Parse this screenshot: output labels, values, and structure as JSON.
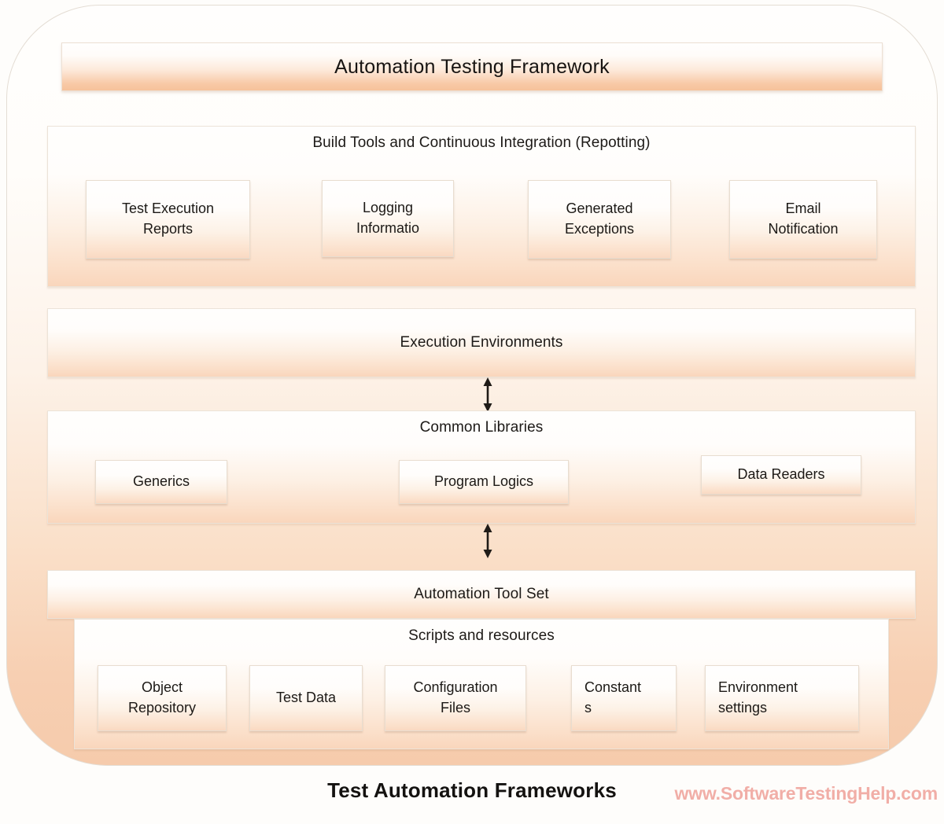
{
  "diagram": {
    "header": {
      "title": "Automation Testing Framework"
    },
    "sections": [
      {
        "id": "build",
        "title": "Build Tools and Continuous Integration (Repotting)",
        "nodes": [
          {
            "id": "reports",
            "lines": [
              "Test Execution",
              "Reports"
            ]
          },
          {
            "id": "logging",
            "lines": [
              "Logging",
              "Informatio"
            ]
          },
          {
            "id": "exceptions",
            "lines": [
              "Generated",
              "Exceptions"
            ]
          },
          {
            "id": "email",
            "lines": [
              "Email",
              "Notification"
            ]
          }
        ]
      },
      {
        "id": "exec",
        "title": "Execution Environments",
        "nodes": []
      },
      {
        "id": "common",
        "title": "Common Libraries",
        "nodes": [
          {
            "id": "generics",
            "lines": [
              "Generics"
            ]
          },
          {
            "id": "logics",
            "lines": [
              "Program Logics"
            ]
          },
          {
            "id": "readers",
            "lines": [
              "Data Readers"
            ]
          }
        ]
      },
      {
        "id": "toolset",
        "title": "Automation Tool Set",
        "nodes": []
      },
      {
        "id": "scripts",
        "title": "Scripts and resources",
        "nodes": [
          {
            "id": "objrepo",
            "lines": [
              "Object",
              "Repository"
            ]
          },
          {
            "id": "testdata",
            "lines": [
              "Test Data"
            ]
          },
          {
            "id": "configfile",
            "lines": [
              "Configuration",
              "Files"
            ]
          },
          {
            "id": "constants",
            "lines": [
              "Constant",
              "s"
            ]
          },
          {
            "id": "envsett",
            "lines": [
              "Environment",
              "settings"
            ]
          }
        ]
      }
    ],
    "connectors": [
      {
        "id": "exec-to-common",
        "kind": "double-arrow-vertical"
      },
      {
        "id": "common-to-toolset",
        "kind": "double-arrow-vertical"
      }
    ],
    "caption": "Test Automation Frameworks",
    "watermark": "www.SoftwareTestingHelp.com",
    "colors": {
      "accent_peach": "#f7cfb2",
      "panel_light": "#fffefd",
      "text": "#1c1916",
      "watermark": "#f0a8a0",
      "arrow": "#1f1b17"
    }
  }
}
